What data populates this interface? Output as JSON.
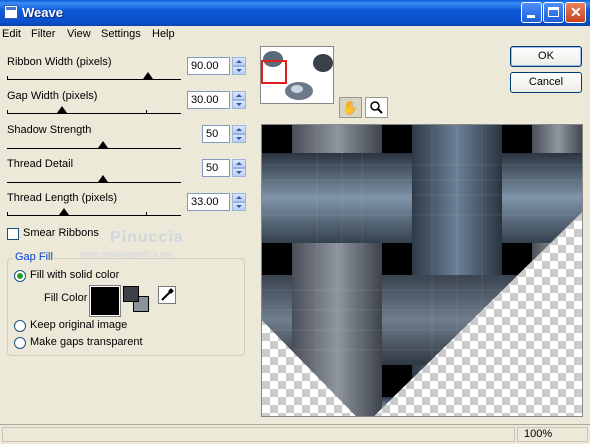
{
  "window": {
    "title": "Weave"
  },
  "menu": [
    "Edit",
    "Filter",
    "View",
    "Settings",
    "Help"
  ],
  "sliders": [
    {
      "label": "Ribbon Width (pixels)",
      "value": "90.00"
    },
    {
      "label": "Gap Width (pixels)",
      "value": "30.00"
    },
    {
      "label": "Shadow Strength",
      "value": "50"
    },
    {
      "label": "Thread Detail",
      "value": "50"
    },
    {
      "label": "Thread Length (pixels)",
      "value": "33.00"
    }
  ],
  "smear": {
    "label": "Smear Ribbons",
    "checked": false
  },
  "watermark": {
    "name": "Pinuccia",
    "url": "www.maidiregrafica.eu"
  },
  "gap_fill": {
    "title": "Gap Fill",
    "fill_solid_label": "Fill with solid color",
    "fill_color_label": "Fill Color",
    "keep_label": "Keep original image",
    "transparent_label": "Make gaps transparent",
    "selected": "fill_solid",
    "fill_color": "#000000",
    "fg_color": "#3a3f48",
    "bg_color": "#8a939b"
  },
  "buttons": {
    "ok": "OK",
    "cancel": "Cancel"
  },
  "status": {
    "zoom": "100%"
  },
  "icons": [
    "hand-pan-icon",
    "zoom-magnifier-icon",
    "eyedropper-icon",
    "minimize-icon",
    "maximize-icon",
    "close-icon"
  ]
}
